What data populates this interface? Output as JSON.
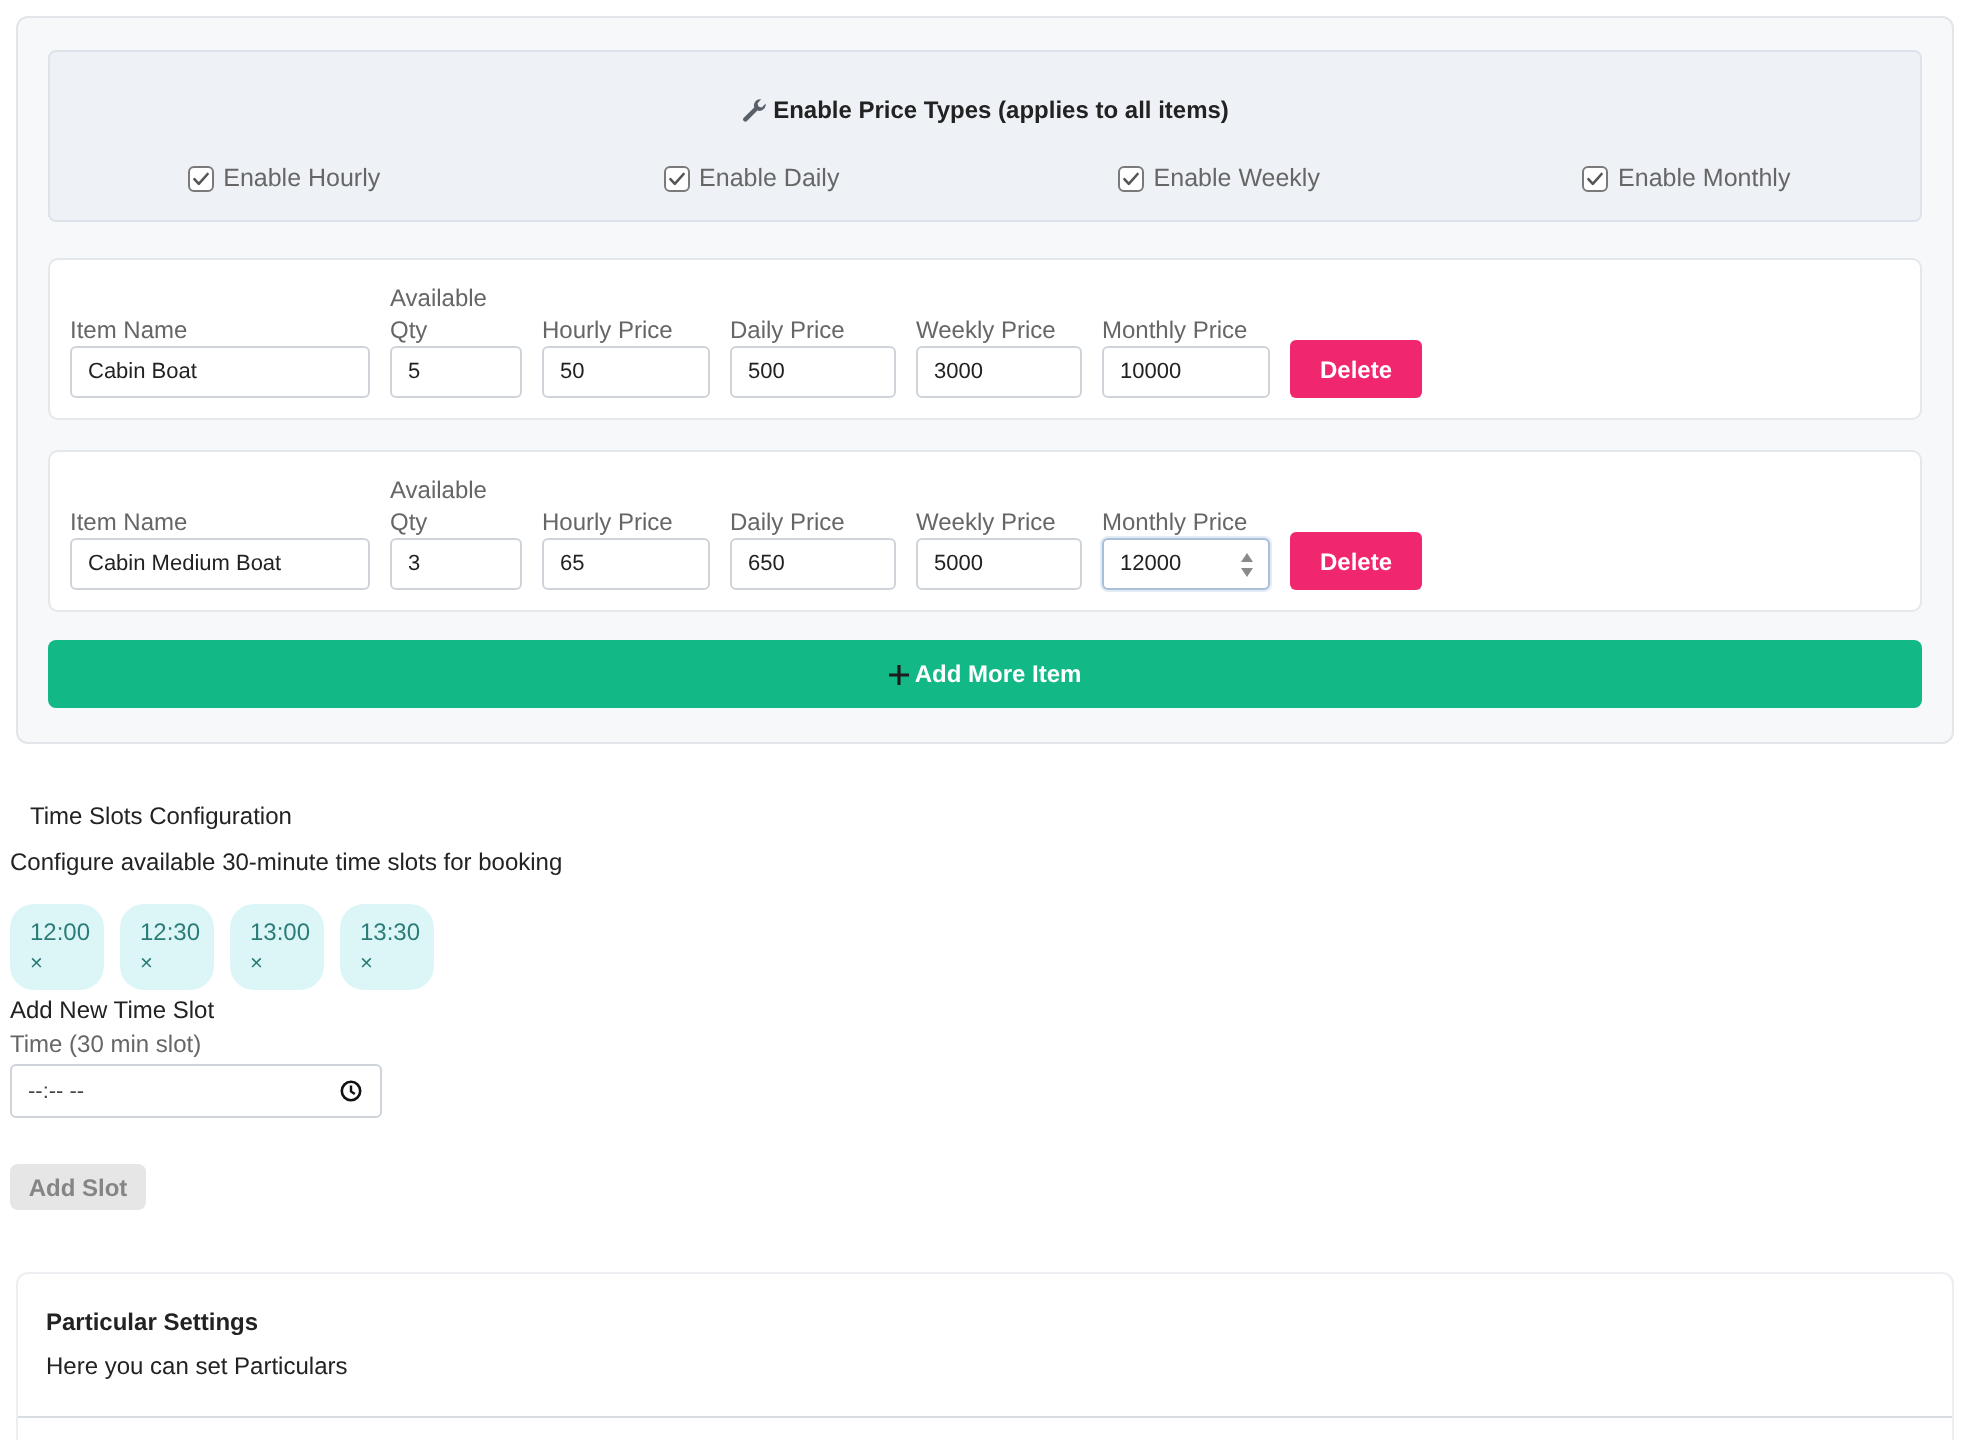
{
  "price_types": {
    "title": "Enable Price Types (applies to all items)",
    "options": [
      {
        "label": "Enable Hourly",
        "checked": true
      },
      {
        "label": "Enable Daily",
        "checked": true
      },
      {
        "label": "Enable Weekly",
        "checked": true
      },
      {
        "label": "Enable Monthly",
        "checked": true
      }
    ]
  },
  "items": [
    {
      "fields": [
        {
          "label": "Item Name",
          "value": "Cabin Boat",
          "focused": false
        },
        {
          "label": "Available Qty",
          "value": "5",
          "focused": false
        },
        {
          "label": "Hourly Price",
          "value": "50",
          "focused": false
        },
        {
          "label": "Daily Price",
          "value": "500",
          "focused": false
        },
        {
          "label": "Weekly Price",
          "value": "3000",
          "focused": false
        },
        {
          "label": "Monthly Price",
          "value": "10000",
          "focused": false
        }
      ],
      "delete_button": "Delete"
    },
    {
      "fields": [
        {
          "label": "Item Name",
          "value": "Cabin Medium Boat",
          "focused": false
        },
        {
          "label": "Available Qty",
          "value": "3",
          "focused": false
        },
        {
          "label": "Hourly Price",
          "value": "65",
          "focused": false
        },
        {
          "label": "Daily Price",
          "value": "650",
          "focused": false
        },
        {
          "label": "Weekly Price",
          "value": "5000",
          "focused": false
        },
        {
          "label": "Monthly Price",
          "value": "12000",
          "focused": true
        }
      ],
      "delete_button": "Delete"
    }
  ],
  "add_item_button": "Add More Item",
  "time_slots": {
    "title": "Time Slots Configuration",
    "description": "Configure available 30-minute time slots for booking",
    "slots": [
      {
        "time": "12:00",
        "remove": "×"
      },
      {
        "time": "12:30",
        "remove": "×"
      },
      {
        "time": "13:00",
        "remove": "×"
      },
      {
        "time": "13:30",
        "remove": "×"
      }
    ],
    "add_title": "Add New Time Slot",
    "field_label": "Time (30 min slot)",
    "placeholder": "--:-- --",
    "add_button": {
      "label": "Add Slot",
      "disabled": true
    }
  },
  "particular_settings": {
    "title": "Particular Settings",
    "description": "Here you can set Particulars"
  }
}
